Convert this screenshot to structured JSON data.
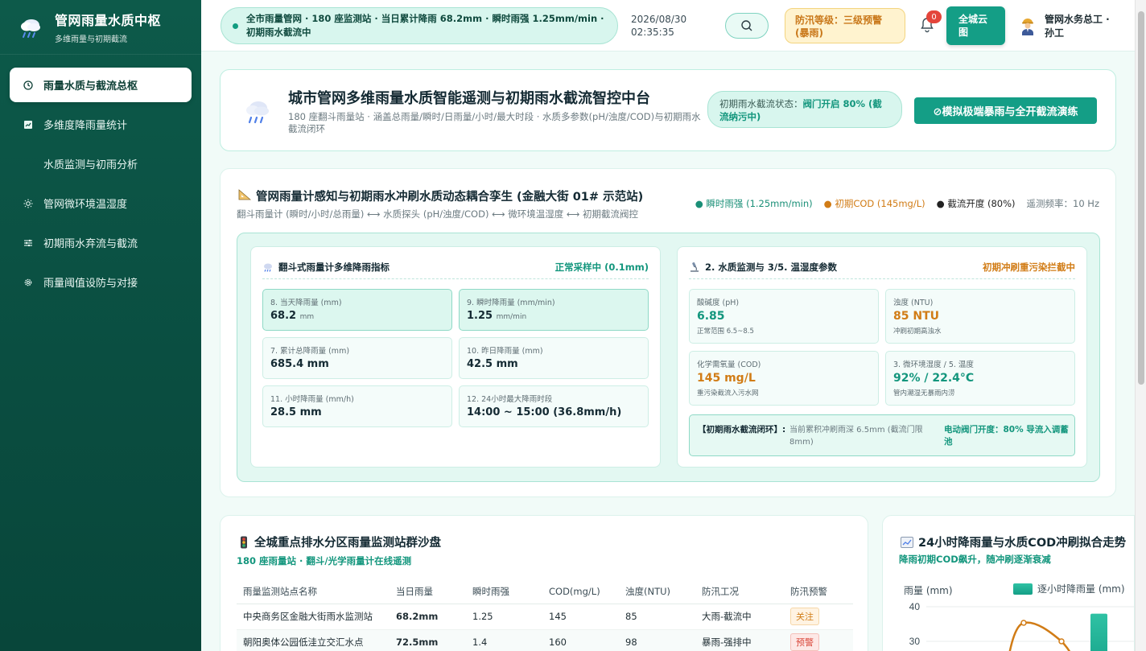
{
  "sidebar": {
    "brand_title": "管网雨量水质中枢",
    "brand_sub": "多维雨量与初期截流",
    "items": [
      {
        "label": "雨量水质与截流总枢",
        "icon": "clock-icon"
      },
      {
        "label": "多维度降雨量统计",
        "icon": "chart-icon"
      },
      {
        "label": "水质监测与初雨分析",
        "icon": ""
      },
      {
        "label": "管网微环境温湿度",
        "icon": "sun-icon"
      },
      {
        "label": "初期雨水弃流与截流",
        "icon": "sliders-icon"
      },
      {
        "label": "雨量阈值设防与对接",
        "icon": "gear-icon"
      }
    ]
  },
  "header": {
    "ticker": "全市雨量管网 · 180 座监测站 · 当日累计降雨 68.2mm · 瞬时雨强 1.25mm/min · 初期雨水截流中",
    "date": "2026/08/30",
    "time": "02:35:35",
    "flood_level": "防汛等级：三级预警(暴雨)",
    "notify_count": "0",
    "cloud_btn": "全城云图",
    "user": "管网水务总工 · 孙工"
  },
  "hero": {
    "title": "城市管网多维雨量水质智能遥测与初期雨水截流智控中台",
    "sub": "180 座翻斗雨量站 · 涵盖总雨量/瞬时/日雨量/小时/最大时段 · 水质多参数(pH/浊度/COD)与初期雨水截流闭环",
    "status_label": "初期雨水截流状态：",
    "status_value": "阀门开启 80% (截流纳污中)",
    "action": "⊘模拟极端暴雨与全开截流演练"
  },
  "twin": {
    "title": "管网雨量计感知与初期雨水冲刷水质动态耦合孪生 (金融大街 01# 示范站)",
    "sub": "翻斗雨量计 (瞬时/小时/总雨量) ⟷ 水质探头 (pH/浊度/COD) ⟷ 微环境温湿度 ⟷ 初期截流阀控",
    "legend": [
      "● 瞬时雨强 (1.25mm/min)",
      "● 初期COD (145mg/L)",
      "● 截流开度 (80%)",
      "遥测频率：10 Hz"
    ],
    "rain": {
      "title": "翻斗式雨量计多维降雨指标",
      "state": "正常采样中 (0.1mm)",
      "metrics": [
        {
          "label": "8. 当天降雨量 (mm)",
          "value": "68.2",
          "unit": "mm"
        },
        {
          "label": "9. 瞬时降雨量 (mm/min)",
          "value": "1.25",
          "unit": "mm/min"
        },
        {
          "label": "7. 累计总降雨量 (mm)",
          "value": "685.4 mm",
          "unit": ""
        },
        {
          "label": "10. 昨日降雨量 (mm)",
          "value": "42.5 mm",
          "unit": ""
        },
        {
          "label": "11. 小时降雨量 (mm/h)",
          "value": "28.5 mm",
          "unit": ""
        },
        {
          "label": "12. 24小时最大降雨时段",
          "value": "14:00 ~ 15:00 (36.8mm/h)",
          "unit": ""
        }
      ]
    },
    "water": {
      "title": "2. 水质监测与 3/5. 温湿度参数",
      "state": "初期冲刷重污染拦截中",
      "metrics": [
        {
          "label": "酸碱度 (pH)",
          "value": "6.85",
          "note": "正常范围 6.5~8.5"
        },
        {
          "label": "浊度 (NTU)",
          "value": "85 NTU",
          "note": "冲刷初期高浊水"
        },
        {
          "label": "化学需氧量 (COD)",
          "value": "145 mg/L",
          "note": "重污染截流入污水网"
        },
        {
          "label": "3. 微环境湿度 / 5. 温度",
          "value": "92% / 22.4°C",
          "note": "管内潮湿无暴雨内涝"
        }
      ],
      "intercept_label": "【初期雨水截流闭环】:",
      "intercept_desc": "当前累积冲刷雨深 6.5mm (截流门限 8mm)",
      "intercept_valve": "电动阀门开度：80% 导流入调蓄池"
    }
  },
  "stations": {
    "title": "全城重点排水分区雨量监测站群沙盘",
    "sub": "180 座雨量站 · 翻斗/光学雨量计在线遥测",
    "columns": [
      "雨量监测站点名称",
      "当日雨量",
      "瞬时雨强",
      "COD(mg/L)",
      "浊度(NTU)",
      "防汛工况",
      "防汛预警"
    ],
    "rows": [
      {
        "name": "中央商务区金融大街雨水监测站",
        "rain": "68.2mm",
        "rate": "1.25",
        "cod": "145",
        "ntu": "85",
        "cond": "大雨-截流中",
        "alert": "关注",
        "level": "watch"
      },
      {
        "name": "朝阳奥体公园低洼立交汇水点",
        "rain": "72.5mm",
        "rate": "1.4",
        "cod": "160",
        "ntu": "98",
        "cond": "暴雨-强排中",
        "alert": "预警",
        "level": "warn"
      }
    ]
  },
  "trend": {
    "title": "24小时降雨量与水质COD冲刷拟合走势",
    "sub": "降雨初期COD飙升，随冲刷逐渐衰减",
    "ylabel": "雨量 (mm)",
    "legend_bar": "逐小时降雨量 (mm)",
    "accent": "#149e86",
    "cod_color": "#d17c16"
  },
  "chart_data": {
    "type": "bar",
    "ylabel": "雨量 (mm)",
    "ylim_visible": [
      30,
      40
    ],
    "yticks": [
      40,
      30
    ],
    "series": [
      {
        "name": "逐小时降雨量 (mm)",
        "type": "bar",
        "visible_values": [
          38
        ]
      }
    ]
  }
}
